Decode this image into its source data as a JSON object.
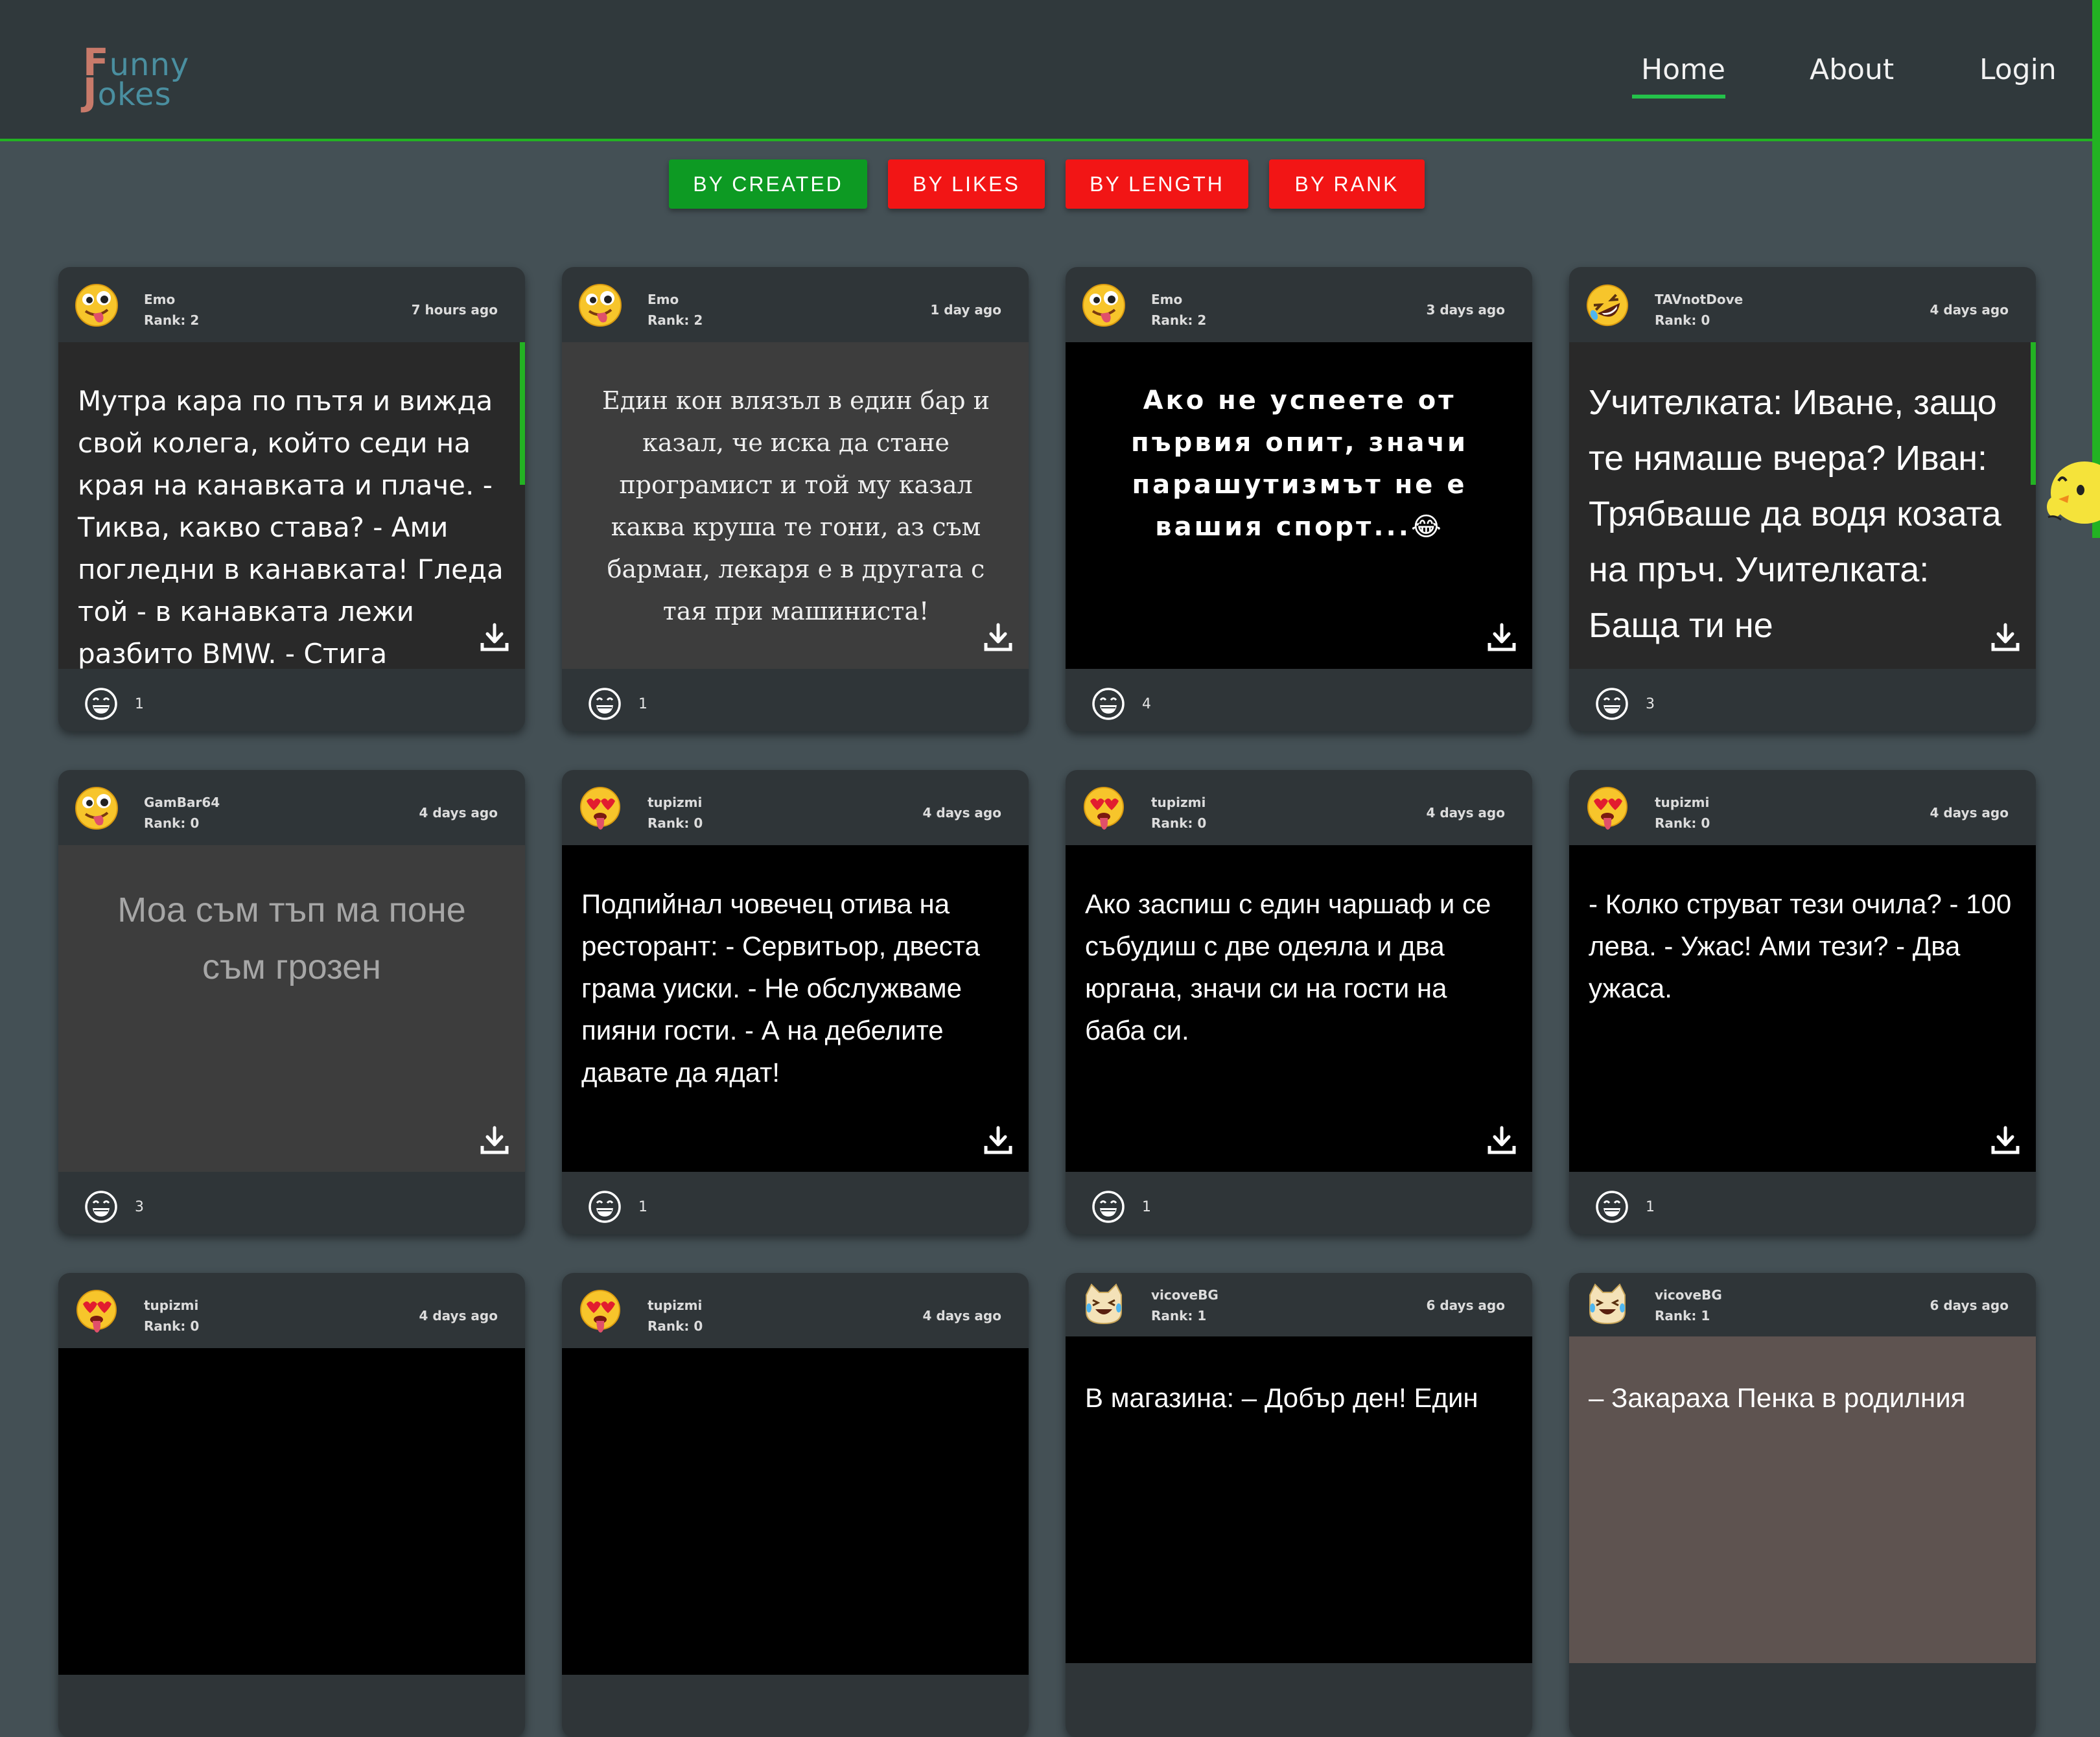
{
  "app": {
    "logo_top": "unny",
    "logo_top_cap": "F",
    "logo_bottom": "okes",
    "logo_bottom_cap": "J"
  },
  "nav": {
    "home": "Home",
    "about": "About",
    "login": "Login",
    "active": "Home"
  },
  "sort": {
    "created": "BY CREATED",
    "likes": "BY LIKES",
    "length": "BY LENGTH",
    "rank": "BY RANK",
    "active": "BY CREATED"
  },
  "colors": {
    "accent": "#23b223",
    "active_button": "#0d9a23",
    "inactive_button": "#f21515",
    "background": "#445055",
    "header": "#30393c",
    "card": "#2f3538"
  },
  "jokes": [
    {
      "author": "Emo",
      "rank": "Rank: 2",
      "time": "7 hours ago",
      "avatar_icon": "tongue-face-icon",
      "text": "Мутра кара по пътя и вижда свой колега, който седи на края на канавката и плаче. - Тиква, какво става? - Ами погледни в канавката! Гледа той - в канавката лежи разбито BMW. - Стига",
      "likes": "1"
    },
    {
      "author": "Emo",
      "rank": "Rank: 2",
      "time": "1 day ago",
      "avatar_icon": "tongue-face-icon",
      "text": "Един кон влязъл в един бар и казал, че иска да стане програмист и той му казал каква круша те гони, аз съм барман, лекаря е в другата с тая при машиниста!",
      "likes": "1"
    },
    {
      "author": "Emo",
      "rank": "Rank: 2",
      "time": "3 days ago",
      "avatar_icon": "tongue-face-icon",
      "text": "Ако не успеете от първия опит, значи парашутизмът не е вашия спорт...😂",
      "likes": "4"
    },
    {
      "author": "TAVnotDove",
      "rank": "Rank: 0",
      "time": "4 days ago",
      "avatar_icon": "rofl-face-icon",
      "text": "Учителката: Иване, защо те нямаше вчера? Иван: Трябваше да водя козата на пръч. Учителката: Баща ти не",
      "likes": "3"
    },
    {
      "author": "GamBar64",
      "rank": "Rank: 0",
      "time": "4 days ago",
      "avatar_icon": "tongue-face-icon",
      "text": "Моа съм тъп ма поне съм грозен",
      "likes": "3"
    },
    {
      "author": "tupizmi",
      "rank": "Rank: 0",
      "time": "4 days ago",
      "avatar_icon": "heart-eyes-tongue-icon",
      "text": "Подпийнал човечец отива на ресторант: - Сервитьор, двеста грама уиски. - Не обслужваме пияни гости. - А на дебелите давате да ядат!",
      "likes": "1"
    },
    {
      "author": "tupizmi",
      "rank": "Rank: 0",
      "time": "4 days ago",
      "avatar_icon": "heart-eyes-tongue-icon",
      "text": "Ако заспиш с един чаршаф и се събудиш с две одеяла и два юргана, значи си на гости на баба си.",
      "likes": "1"
    },
    {
      "author": "tupizmi",
      "rank": "Rank: 0",
      "time": "4 days ago",
      "avatar_icon": "heart-eyes-tongue-icon",
      "text": "- Колко струват тези очила? - 100 лева. - Ужас! Ами тези? - Два ужаса.",
      "likes": "1"
    },
    {
      "author": "tupizmi",
      "rank": "Rank: 0",
      "time": "4 days ago",
      "avatar_icon": "heart-eyes-tongue-icon",
      "text": "",
      "likes": ""
    },
    {
      "author": "tupizmi",
      "rank": "Rank: 0",
      "time": "4 days ago",
      "avatar_icon": "heart-eyes-tongue-icon",
      "text": "",
      "likes": ""
    },
    {
      "author": "vicoveBG",
      "rank": "Rank: 1",
      "time": "6 days ago",
      "avatar_icon": "laughing-cat-icon",
      "text": "В магазина: – Добър ден! Един",
      "likes": ""
    },
    {
      "author": "vicoveBG",
      "rank": "Rank: 1",
      "time": "6 days ago",
      "avatar_icon": "laughing-cat-icon",
      "text": "– Закараха Пенка в родилния",
      "likes": ""
    }
  ]
}
